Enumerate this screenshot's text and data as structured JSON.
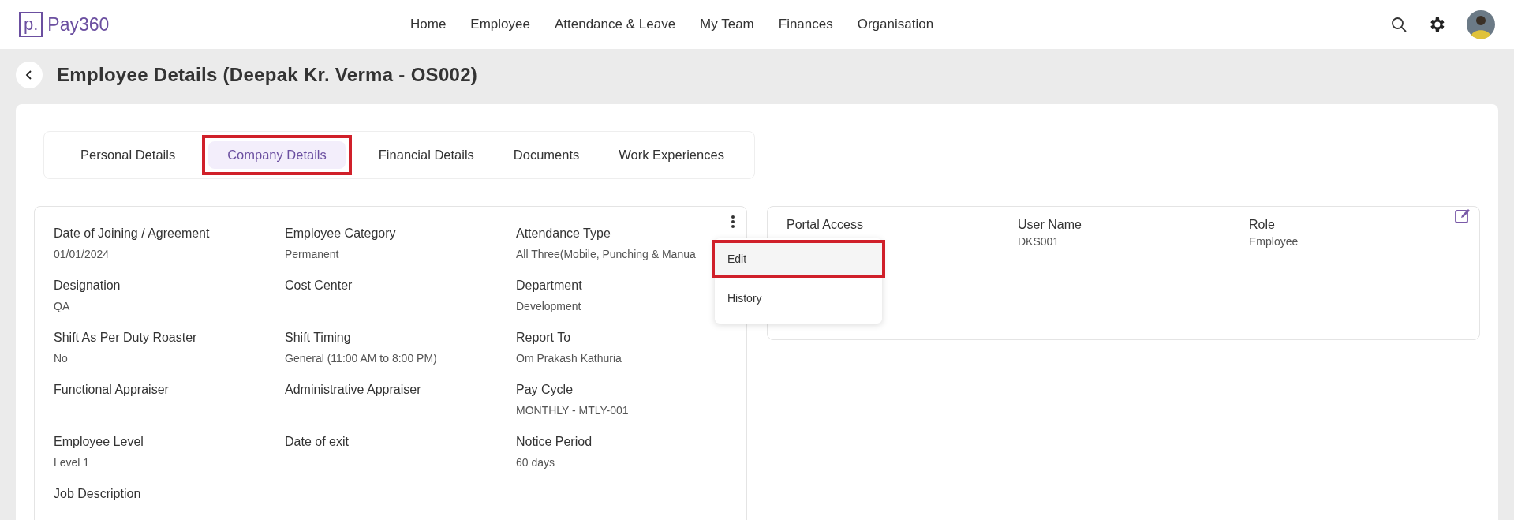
{
  "header": {
    "logo_mark": "p.",
    "logo_text": "Pay360",
    "nav": [
      {
        "label": "Home"
      },
      {
        "label": "Employee"
      },
      {
        "label": "Attendance & Leave"
      },
      {
        "label": "My Team"
      },
      {
        "label": "Finances"
      },
      {
        "label": "Organisation"
      }
    ]
  },
  "page": {
    "title": "Employee Details (Deepak Kr. Verma - OS002)"
  },
  "tabs": [
    {
      "label": "Personal Details",
      "selected": false,
      "highlighted": false
    },
    {
      "label": "Company Details",
      "selected": true,
      "highlighted": true
    },
    {
      "label": "Financial Details",
      "selected": false,
      "highlighted": false
    },
    {
      "label": "Documents",
      "selected": false,
      "highlighted": false
    },
    {
      "label": "Work Experiences",
      "selected": false,
      "highlighted": false
    }
  ],
  "company_details": {
    "fields": [
      {
        "label": "Date of Joining / Agreement",
        "value": "01/01/2024"
      },
      {
        "label": "Employee Category",
        "value": "Permanent"
      },
      {
        "label": "Attendance Type",
        "value": "All Three(Mobile, Punching & Manua"
      },
      {
        "label": "Designation",
        "value": "QA"
      },
      {
        "label": "Cost Center"
      },
      {
        "label": "Department",
        "value": "Development"
      },
      {
        "label": "Shift As Per Duty Roaster",
        "value": "No"
      },
      {
        "label": "Shift Timing",
        "value": "General (11:00 AM to 8:00 PM)"
      },
      {
        "label": "Report To",
        "value": "Om Prakash Kathuria"
      },
      {
        "label": "Functional Appraiser"
      },
      {
        "label": "Administrative Appraiser"
      },
      {
        "label": "Pay Cycle",
        "value": "MONTHLY - MTLY-001"
      },
      {
        "label": "Employee Level",
        "value": "Level 1"
      },
      {
        "label": "Date of exit"
      },
      {
        "label": "Notice Period",
        "value": "60 days"
      },
      {
        "label": "Job Description"
      }
    ],
    "menu": {
      "items": [
        {
          "label": "Edit",
          "highlighted": true
        },
        {
          "label": "History",
          "highlighted": false
        }
      ]
    }
  },
  "portal_card": {
    "fields": [
      {
        "label": "Portal Access"
      },
      {
        "label": "User Name",
        "value": "DKS001"
      },
      {
        "label": "Role",
        "value": "Employee"
      }
    ]
  }
}
